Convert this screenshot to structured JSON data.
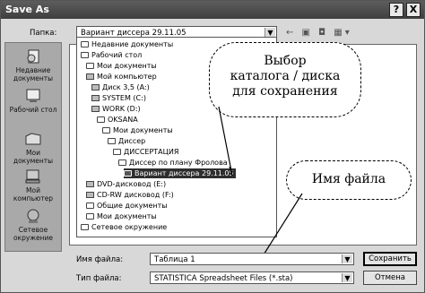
{
  "window": {
    "title": "Save As",
    "help_glyph": "?",
    "close_glyph": "X"
  },
  "folder_label": "Папка:",
  "folder_combo_value": "Вариант диссера 29.11.05",
  "toolbar_icons": "← ▣ ◘ ▦▾",
  "places": [
    {
      "icon": "recent-documents-icon",
      "label": "Недавние документы"
    },
    {
      "icon": "desktop-icon",
      "label": "Рабочий стол"
    },
    {
      "icon": "my-documents-icon",
      "label": "Мои документы"
    },
    {
      "icon": "my-computer-icon",
      "label": "Мой компьютер"
    },
    {
      "icon": "network-icon",
      "label": "Сетевое окружение"
    }
  ],
  "tree": [
    {
      "label": "Недавние документы",
      "icon": "folder"
    },
    {
      "label": "Рабочий стол",
      "icon": "folder"
    },
    {
      "label": "Мои документы",
      "icon": "folder"
    },
    {
      "label": "Мой компьютер",
      "icon": "drive"
    },
    {
      "label": "Диск 3,5 (A:)",
      "icon": "drive"
    },
    {
      "label": "SYSTEM (C:)",
      "icon": "drive"
    },
    {
      "label": "WORK (D:)",
      "icon": "drive"
    },
    {
      "label": "OKSANA",
      "icon": "folder"
    },
    {
      "label": "Мои документы",
      "icon": "folder"
    },
    {
      "label": "Диссер",
      "icon": "folder"
    },
    {
      "label": "ДИССЕРТАЦИЯ",
      "icon": "folder"
    },
    {
      "label": "Диссер по плану Фролова",
      "icon": "folder"
    },
    {
      "label": "Вариант диссера 29.11.05",
      "icon": "folder",
      "selected": true
    },
    {
      "label": "DVD-дисковод (E:)",
      "icon": "drive"
    },
    {
      "label": "CD-RW дисковод (F:)",
      "icon": "drive"
    },
    {
      "label": "Общие документы",
      "icon": "folder"
    },
    {
      "label": "Мои документы",
      "icon": "folder"
    },
    {
      "label": "Сетевое окружение",
      "icon": "folder"
    }
  ],
  "filename": {
    "label": "Имя файла:",
    "value": "Таблица 1"
  },
  "filetype": {
    "label": "Тип файла:",
    "value": "STATISTICA Spreadsheet Files (*.sta)"
  },
  "buttons": {
    "save": "Сохранить",
    "cancel": "Отмена"
  },
  "callouts": {
    "folder": [
      "Выбор",
      "каталога / диска",
      "для сохранения"
    ],
    "filename": "Имя файла"
  }
}
